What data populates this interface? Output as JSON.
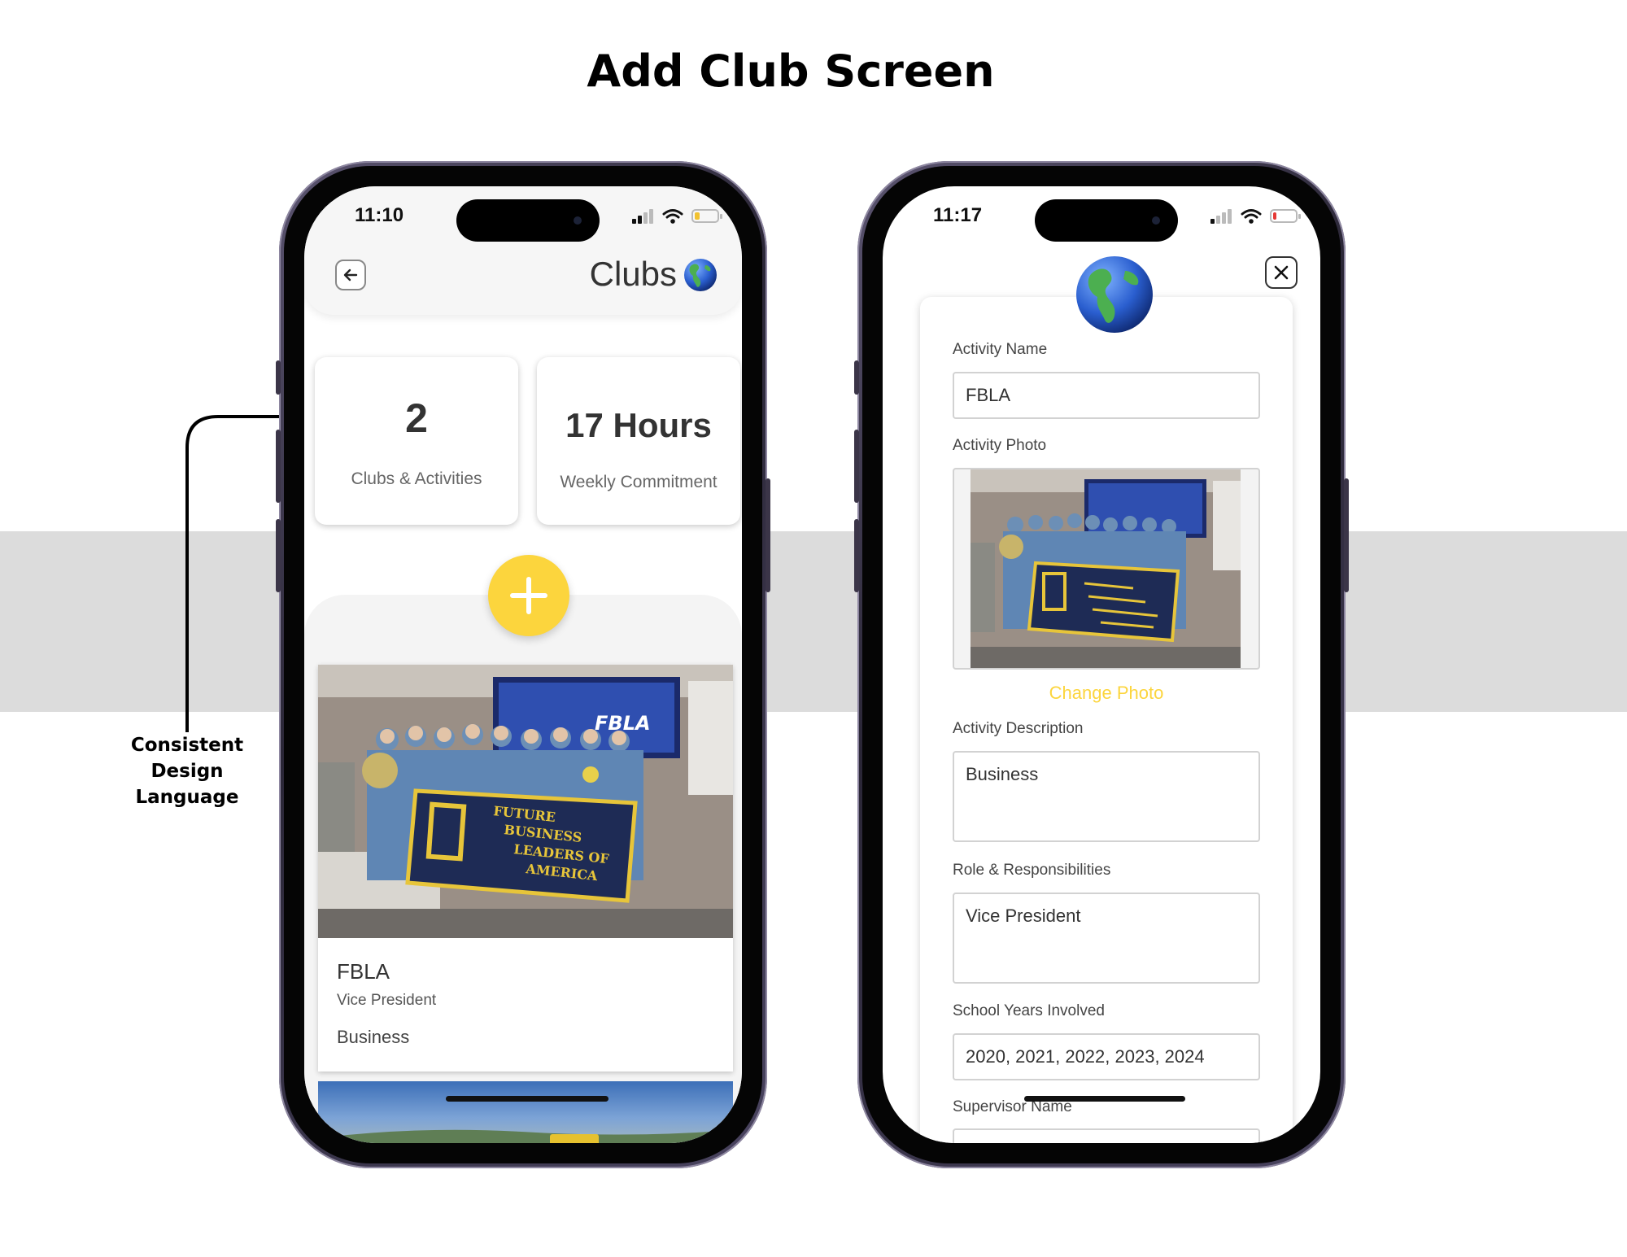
{
  "page": {
    "title": "Add Club Screen"
  },
  "annotation": {
    "lines": [
      "Consistent",
      "Design",
      "Language"
    ]
  },
  "left_phone": {
    "time": "11:10",
    "header": {
      "title": "Clubs"
    },
    "stats": [
      {
        "value": "2",
        "label": "Clubs & Activities"
      },
      {
        "value": "17 Hours",
        "label": "Weekly Commitment"
      }
    ],
    "club_card": {
      "title": "FBLA",
      "role": "Vice President",
      "description": "Business",
      "photo_banner": {
        "line1": "FUTURE",
        "line2": "BUSINESS",
        "line3": "LEADERS OF",
        "line4": "AMERICA",
        "screen_text": "FBLA"
      }
    }
  },
  "right_phone": {
    "time": "11:17",
    "form": {
      "activity_name_label": "Activity Name",
      "activity_name_value": "FBLA",
      "activity_photo_label": "Activity Photo",
      "change_photo": "Change Photo",
      "description_label": "Activity Description",
      "description_value": "Business",
      "role_label": "Role & Responsibilities",
      "role_value": "Vice President",
      "years_label": "School Years Involved",
      "years_value": "2020, 2021, 2022, 2023, 2024",
      "supervisor_label": "Supervisor Name"
    }
  },
  "colors": {
    "accent": "#fcd53d",
    "band": "#dcdcdc"
  },
  "icons": [
    "back-arrow-icon",
    "globe-icon",
    "plus-icon",
    "close-icon",
    "signal-icon",
    "wifi-icon",
    "battery-icon"
  ]
}
